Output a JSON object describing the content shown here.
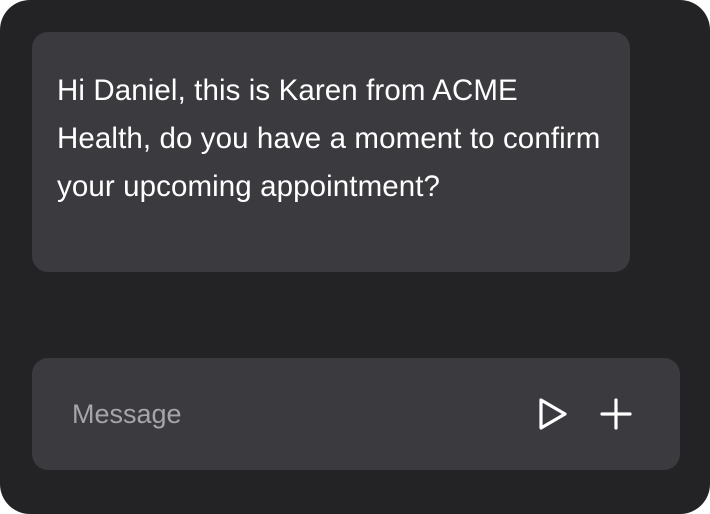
{
  "chat": {
    "incoming_message": "Hi Daniel, this is Karen from ACME Health, do you have a moment to confirm your upcoming appointment?"
  },
  "composer": {
    "placeholder": "Message",
    "value": "",
    "send_icon": "play-triangle-icon",
    "add_icon": "plus-icon"
  },
  "colors": {
    "panel_background": "#232225",
    "bubble_background": "#3b3a3e",
    "text": "#ffffff",
    "placeholder": "#a6a5aa"
  }
}
